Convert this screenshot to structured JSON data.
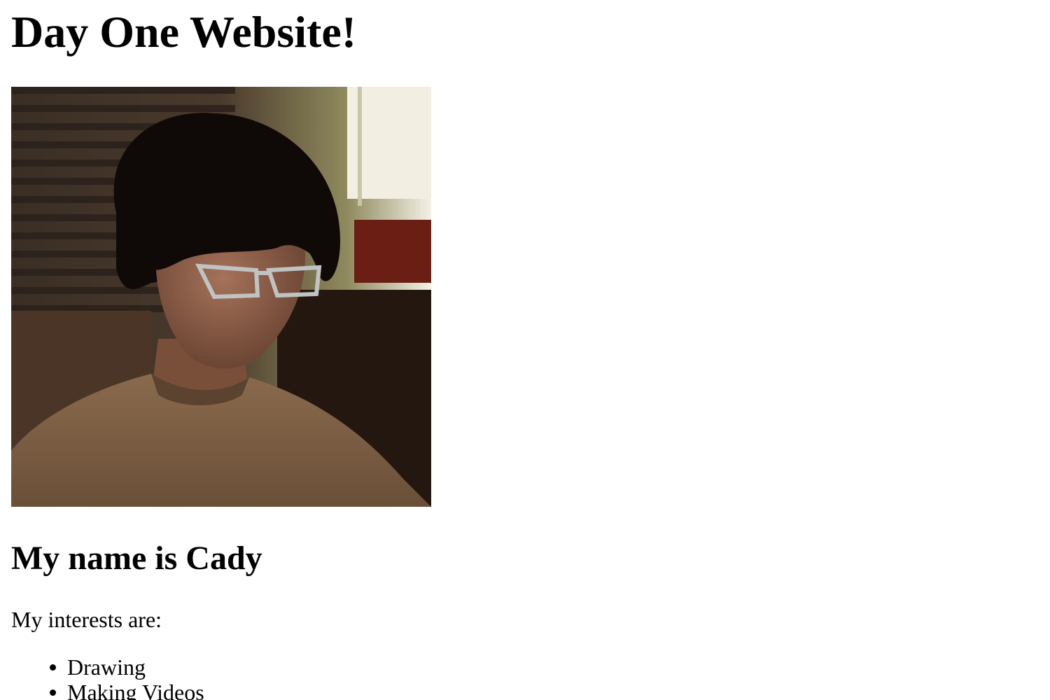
{
  "page": {
    "title": "Day One Website!",
    "heading": "My name is Cady",
    "intro": "My interests are:",
    "interests": [
      "Drawing",
      "Making Videos"
    ]
  },
  "photo": {
    "subject": "portrait-photo"
  }
}
